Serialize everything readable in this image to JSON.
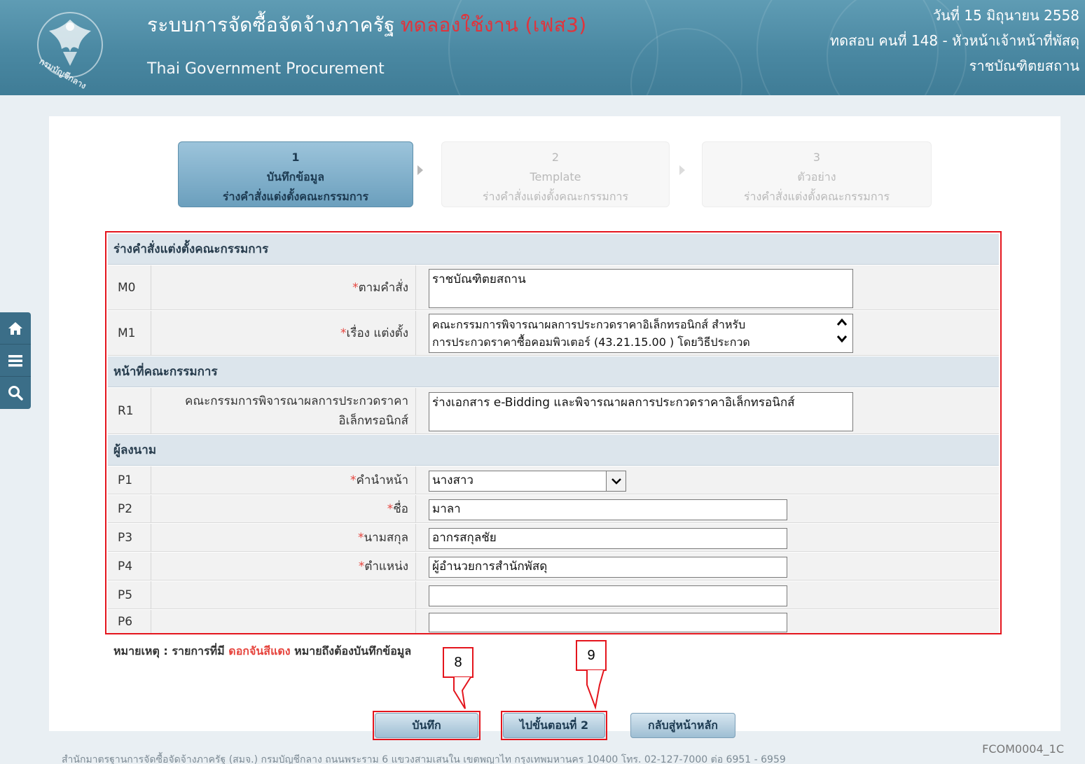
{
  "header": {
    "title": "ระบบการจัดซื้อจัดจ้างภาครัฐ",
    "title_badge": "ทดลองใช้งาน (เฟส3)",
    "subtitle": "Thai Government Procurement",
    "date": "วันที่ 15 มิถุนายน 2558",
    "user": "ทดสอบ คนที่ 148 - หัวหน้าเจ้าหน้าที่พัสดุ",
    "org": "ราชบัณฑิตยสถาน",
    "emblem_text": "กรมบัญชีกลาง",
    "icon": "garuda-emblem-icon"
  },
  "quickbar": {
    "items": [
      {
        "icon": "home-icon"
      },
      {
        "icon": "menu-icon"
      },
      {
        "icon": "search-icon"
      }
    ]
  },
  "steps": [
    {
      "number": "1",
      "line1": "บันทึกข้อมูล",
      "line2": "ร่างคำสั่งแต่งตั้งคณะกรรมการ",
      "state": "active"
    },
    {
      "number": "2",
      "line1": "Template",
      "line2": "ร่างคำสั่งแต่งตั้งคณะกรรมการ",
      "state": "inactive"
    },
    {
      "number": "3",
      "line1": "ตัวอย่าง",
      "line2": "ร่างคำสั่งแต่งตั้งคณะกรรมการ",
      "state": "inactive"
    }
  ],
  "form": {
    "section1": "ร่างคำสั่งแต่งตั้งคณะกรรมการ",
    "m0": {
      "code": "M0",
      "label": "ตามคำสั่ง",
      "value": "ราชบัณฑิตยสถาน"
    },
    "m1": {
      "code": "M1",
      "label": "เรื่อง แต่งตั้ง",
      "line1": "คณะกรรมการพิจารณาผลการประกวดราคาอิเล็กทรอนิกส์ สำหรับ",
      "line2": "การประกวดราคาซื้อคอมพิวเตอร์ (43.21.15.00 ) โดยวิธีประกวด"
    },
    "section2": "หน้าที่คณะกรรมการ",
    "r1": {
      "code": "R1",
      "label_line1": "คณะกรรมการพิจารณาผลการประกวดราคา",
      "label_line2": "อิเล็กทรอนิกส์",
      "value": "ร่างเอกสาร e-Bidding และพิจารณาผลการประกวดราคาอิเล็กทรอนิกส์"
    },
    "section3": "ผู้ลงนาม",
    "p1": {
      "code": "P1",
      "label": "คำนำหน้า",
      "value": "นางสาว"
    },
    "p2": {
      "code": "P2",
      "label": "ชื่อ",
      "value": "มาลา"
    },
    "p3": {
      "code": "P3",
      "label": "นามสกุล",
      "value": "อากรสกุลชัย"
    },
    "p4": {
      "code": "P4",
      "label": "ตำแหน่ง",
      "value": "ผู้อำนวยการสำนักพัสดุ"
    },
    "p5": {
      "code": "P5",
      "value": ""
    },
    "p6": {
      "code": "P6",
      "value": ""
    },
    "required_mark": "*"
  },
  "note": {
    "prefix": "หมายเหตุ : รายการที่มี",
    "red": "ดอกจันสีแดง",
    "suffix": "หมายถึงต้องบันทึกข้อมูล"
  },
  "buttons": {
    "save": "บันทึก",
    "next": "ไปขั้นตอนที่ 2",
    "back": "กลับสู่หน้าหลัก"
  },
  "callouts": {
    "save": "8",
    "next": "9"
  },
  "footer": {
    "code": "FCOM0004_1C",
    "text": "สำนักมาตรฐานการจัดซื้อจัดจ้างภาครัฐ (สมจ.) กรมบัญชีกลาง ถนนพระราม 6 แขวงสามเสนใน เขตพญาไท กรุงเทพมหานคร 10400 โทร. 02-127-7000 ต่อ 6951 - 6959"
  },
  "colors": {
    "header": "#4a88a2",
    "accent_red": "#e4151d",
    "button": "#9ebed3"
  }
}
